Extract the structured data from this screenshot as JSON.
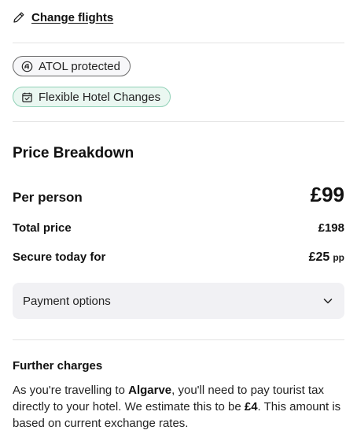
{
  "change_flights": {
    "label": "Change flights",
    "icon": "pencil-icon"
  },
  "badges": [
    {
      "label": "ATOL protected",
      "icon": "atol-shield-icon",
      "border": "#6a6a6a",
      "background": "#f7f7f9"
    },
    {
      "label": "Flexible Hotel Changes",
      "icon": "calendar-check-icon",
      "border": "#8fd0b6",
      "background": "#eaf7f1"
    }
  ],
  "price_breakdown": {
    "title": "Price Breakdown",
    "per_person": {
      "label": "Per person",
      "value": "£99"
    },
    "total": {
      "label": "Total price",
      "value": "£198"
    },
    "secure": {
      "label": "Secure today for",
      "value": "£25",
      "unit": "pp"
    }
  },
  "payment_options": {
    "label": "Payment options",
    "icon": "chevron-down-icon",
    "background": "#f1f1f4"
  },
  "further_charges": {
    "title": "Further charges",
    "text_1": "As you're travelling to ",
    "destination": "Algarve",
    "text_2": ", you'll need to pay tourist tax directly to your hotel. We estimate this to be ",
    "amount": "£4",
    "text_3": ". This amount is based on current exchange rates."
  }
}
